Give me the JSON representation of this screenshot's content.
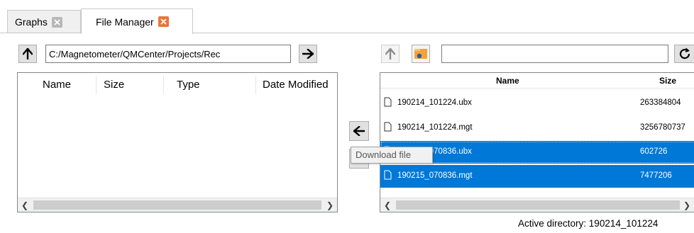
{
  "tabs": [
    {
      "label": "Graphs",
      "active": false
    },
    {
      "label": "File Manager",
      "active": true
    }
  ],
  "left": {
    "path": "C:/Magnetometer/QMCenter/Projects/Rec",
    "columns": [
      "Name",
      "Size",
      "Type",
      "Date Modified"
    ]
  },
  "right": {
    "path": "",
    "columns": [
      "Name",
      "Size"
    ],
    "files": [
      {
        "name": "190214_101224.ubx",
        "size": "263384804",
        "selected": false
      },
      {
        "name": "190214_101224.mgt",
        "size": "3256780737",
        "selected": false
      },
      {
        "name": "190215_070836.ubx",
        "size": "602726",
        "selected": true
      },
      {
        "name": "190215_070836.mgt",
        "size": "7477206",
        "selected": true
      }
    ]
  },
  "tooltip": "Download file",
  "status": {
    "label": "Active directory:",
    "value": "190214_101224"
  },
  "colors": {
    "selection": "#0078d7",
    "close_icon": "#e8763a"
  },
  "icons": [
    "close-icon",
    "arrow-up-icon",
    "arrow-right-icon",
    "arrow-left-icon",
    "folder-icon",
    "refresh-icon",
    "file-icon"
  ]
}
